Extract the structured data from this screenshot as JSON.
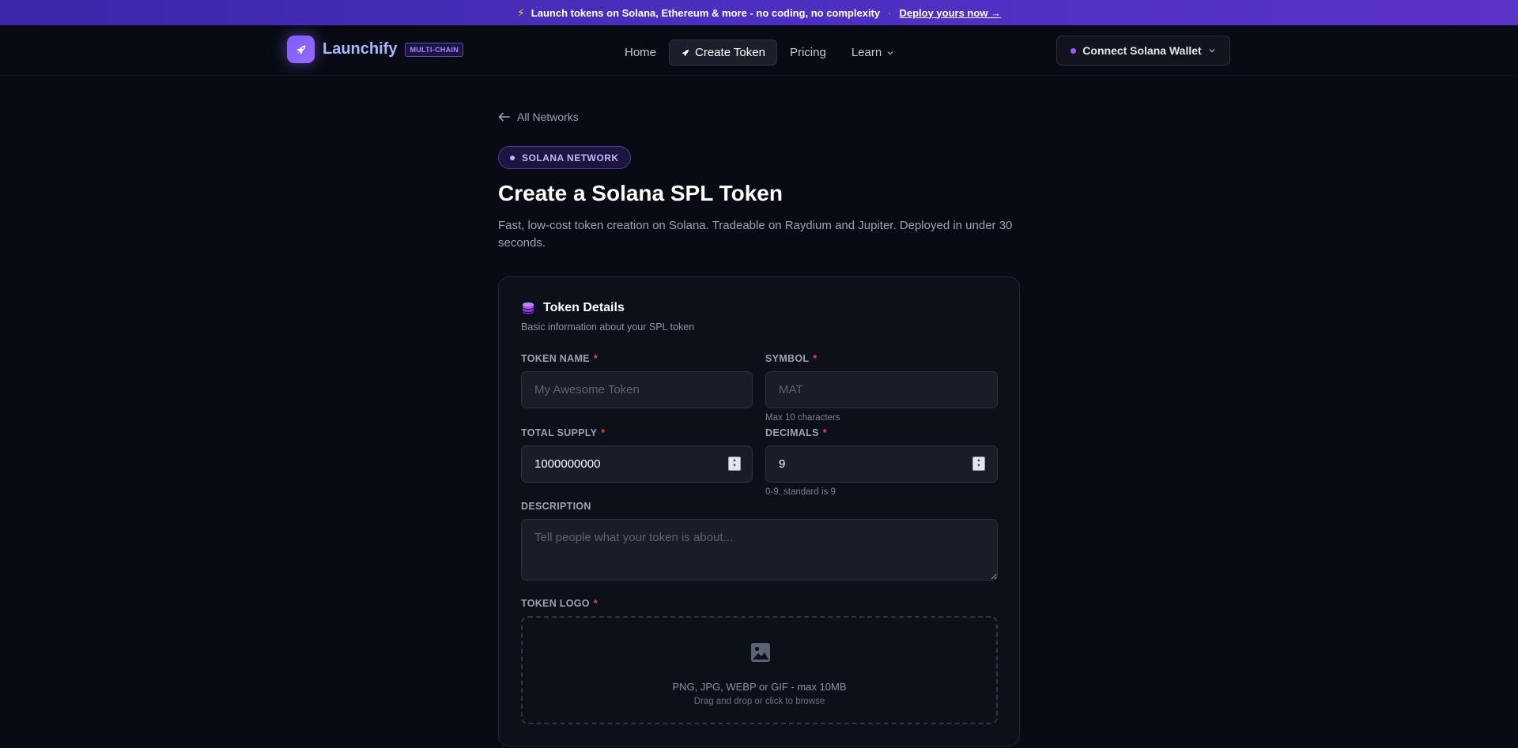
{
  "banner": {
    "icon": "lightning-bolt-icon",
    "message": "Launch tokens on Solana, Ethereum & more - no coding, no complexity",
    "separator": "·",
    "cta": "Deploy yours now →"
  },
  "nav": {
    "logo_icon": "rocket-icon",
    "brand": "Launchify",
    "badge": "MULTI-CHAIN",
    "links": {
      "home": "Home",
      "create_token": "Create Token",
      "pricing": "Pricing",
      "learn": "Learn"
    },
    "wallet_button": "Connect Solana Wallet"
  },
  "back_link": "All Networks",
  "network_pill": "SOLANA NETWORK",
  "page": {
    "title": "Create a Solana SPL Token",
    "subtitle": "Fast, low-cost token creation on Solana. Tradeable on Raydium and Jupiter. Deployed in under 30 seconds."
  },
  "card": {
    "icon": "coins-stack-icon",
    "title": "Token Details",
    "subtitle": "Basic information about your SPL token",
    "fields": {
      "token_name": {
        "label": "TOKEN NAME",
        "required": "*",
        "placeholder": "My Awesome Token",
        "value": ""
      },
      "symbol": {
        "label": "SYMBOL",
        "required": "*",
        "placeholder": "MAT",
        "value": "",
        "hint": "Max 10 characters"
      },
      "total_supply": {
        "label": "TOTAL SUPPLY",
        "required": "*",
        "value": "1000000000"
      },
      "decimals": {
        "label": "DECIMALS",
        "required": "*",
        "value": "9",
        "hint": "0-9, standard is 9"
      },
      "description": {
        "label": "DESCRIPTION",
        "placeholder": "Tell people what your token is about..."
      },
      "token_logo": {
        "label": "TOKEN LOGO",
        "required": "*",
        "icon": "image-icon",
        "formats": "PNG, JPG, WEBP or GIF - max 10MB",
        "instruction": "Drag and drop or click to browse"
      }
    }
  },
  "colors": {
    "accent": "#8b5cf6",
    "background": "#080b14",
    "card": "#0c1019",
    "required": "#ef4444"
  }
}
